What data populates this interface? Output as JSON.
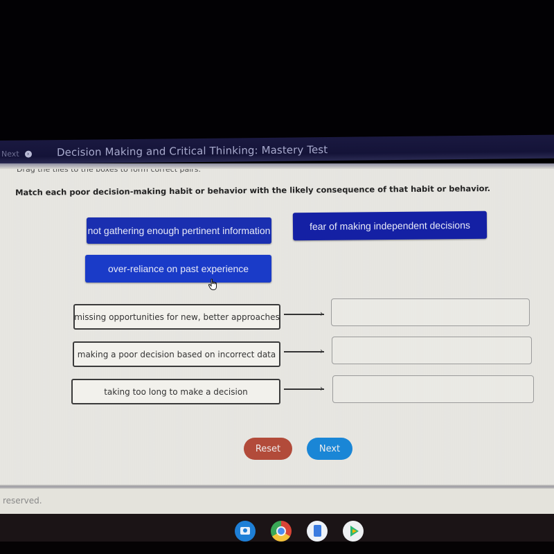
{
  "header": {
    "nav_next_label": "Next",
    "title": "Decision Making and Critical Thinking: Mastery Test"
  },
  "instructions": {
    "drag_hint": "Drag the tiles to the boxes to form correct pairs.",
    "prompt": "Match each poor decision-making habit or behavior with the likely consequence of that habit or behavior."
  },
  "tiles": [
    {
      "label": "not gathering enough pertinent information"
    },
    {
      "label": "fear of making independent decisions"
    },
    {
      "label": "over-reliance on past experience"
    }
  ],
  "pairs": [
    {
      "consequence": "missing opportunities for new, better approaches",
      "answer": ""
    },
    {
      "consequence": "making a poor decision based on incorrect data",
      "answer": ""
    },
    {
      "consequence": "taking too long to make a decision",
      "answer": ""
    }
  ],
  "buttons": {
    "reset": "Reset",
    "next": "Next"
  },
  "footer": {
    "reserved_text": "reserved."
  },
  "shelf": {
    "apps": [
      "camera-icon",
      "chrome-icon",
      "docs-icon",
      "play-store-icon"
    ]
  },
  "colors": {
    "tile_blue": "#1a2fb0",
    "reset_red": "#b24b3a",
    "next_blue": "#1a86d6",
    "header_navy": "#141338"
  }
}
